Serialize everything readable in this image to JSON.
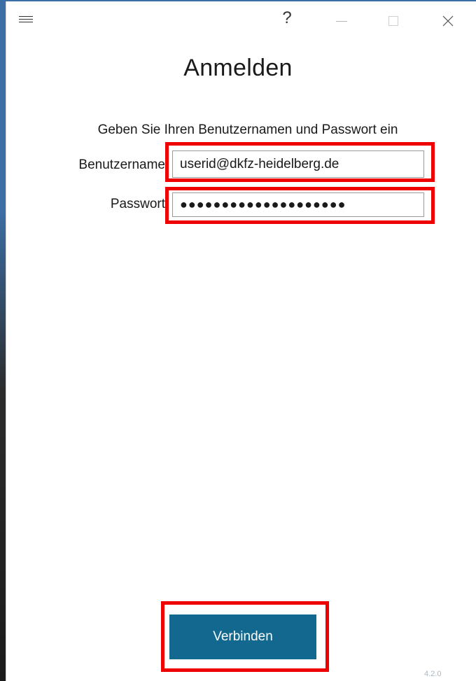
{
  "window": {
    "help_label": "?",
    "icons": {
      "menu": "hamburger-menu-icon",
      "minimize": "minimize-icon",
      "maximize": "maximize-icon",
      "close": "close-icon"
    }
  },
  "login": {
    "title": "Anmelden",
    "instruction": "Geben Sie Ihren Benutzernamen und Passwort ein",
    "username_label": "Benutzername",
    "username_value": "userid@dkfz-heidelberg.de",
    "password_label": "Passwort",
    "password_value": "●●●●●●●●●●●●●●●●●●●●",
    "connect_label": "Verbinden"
  },
  "footer": {
    "version": "4.2.0"
  },
  "colors": {
    "accent": "#12688f",
    "highlight": "#ee0000",
    "version_text": "#a9b6c2"
  }
}
